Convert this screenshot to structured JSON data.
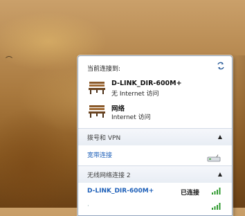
{
  "panel": {
    "header_title": "当前连接到:",
    "networks": [
      {
        "name": "D-LINK_DIR-600M+",
        "status": "无 Internet 访问",
        "icon": "bench-network-icon"
      },
      {
        "name": "网络",
        "status": "Internet 访问",
        "icon": "bench-network-icon"
      }
    ],
    "dialup_section": {
      "label": "拨号和 VPN",
      "chevron": "▲"
    },
    "broadband": {
      "label": "宽带连接",
      "icon": "modem-icon"
    },
    "wireless_section": {
      "label": "无线网络连接 2",
      "chevron": "▲"
    },
    "wifi_list": [
      {
        "name": "D-LINK_DIR-600M+",
        "status": "已连接",
        "icon": "wifi-signal-icon"
      }
    ]
  },
  "icons": {
    "refresh": "refresh-icon"
  },
  "colors": {
    "link_blue": "#1d5fb8",
    "signal_green": "#2f9a2f"
  }
}
